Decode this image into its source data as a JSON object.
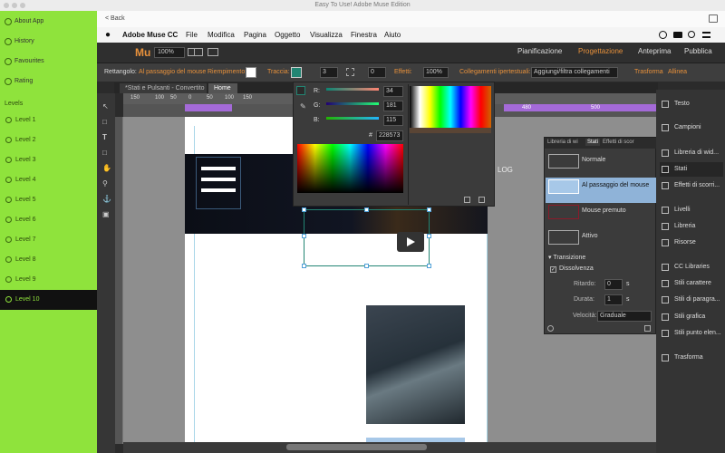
{
  "window": {
    "title": "Easy To Use! Adobe Muse Edition"
  },
  "sidebar": {
    "nav": [
      {
        "label": "About App",
        "icon": "info-icon"
      },
      {
        "label": "History",
        "icon": "clock-icon"
      },
      {
        "label": "Favourites",
        "icon": "heart-icon"
      },
      {
        "label": "Rating",
        "icon": "star-icon"
      }
    ],
    "levels_header": "Levels",
    "levels": [
      "Level 1",
      "Level 2",
      "Level 3",
      "Level 4",
      "Level 5",
      "Level 6",
      "Level 7",
      "Level 8",
      "Level 9",
      "Level 10"
    ],
    "active_level": "Level 10"
  },
  "back": {
    "label": "< Back"
  },
  "menubar": {
    "app": "Adobe Muse CC",
    "items": [
      "File",
      "Modifica",
      "Pagina",
      "Oggetto",
      "Visualizza",
      "Finestra",
      "Aiuto"
    ]
  },
  "appbar": {
    "logo": "Mu",
    "zoom": "100%",
    "modes": [
      "Pianificazione",
      "Progettazione",
      "Anteprima",
      "Pubblica"
    ],
    "active_mode": "Progettazione"
  },
  "propbar": {
    "object_label": "Rettangolo:",
    "state_label": "Al passaggio del mouse",
    "fill_label": "Riempimento:",
    "stroke_label": "Traccia:",
    "stroke_value": "3",
    "corner_value": "0",
    "effects_label": "Effetti:",
    "opacity_value": "100%",
    "links_label": "Collegamenti ipertestuali:",
    "links_value": "Aggiungi/filtra collegamenti",
    "transform_label": "Trasforma",
    "align_label": "Allinea"
  },
  "tabs": [
    "*Stati e Pulsanti - Convertito",
    "Home"
  ],
  "active_tab": "Home",
  "ruler": {
    "top_marks": [
      "150",
      "100",
      "50",
      "0",
      "50",
      "100",
      "150"
    ],
    "right_marks": [
      "480",
      "500"
    ]
  },
  "colorpicker": {
    "r_label": "R:",
    "g_label": "G:",
    "b_label": "B:",
    "r": "34",
    "g": "181",
    "b": "115",
    "hex_label": "#",
    "hex": "228573"
  },
  "stati_panel": {
    "tabs": [
      "Libreria di wi",
      "Stati",
      "Effetti di scor"
    ],
    "active_tab": "Stati",
    "states": [
      {
        "label": "Normale",
        "color": "#3b3b3b",
        "border": "#aaaaaa"
      },
      {
        "label": "Al passaggio del mouse",
        "color": "#a7c8e8",
        "border": "#ffffff"
      },
      {
        "label": "Mouse premuto",
        "color": "#3b3b3b",
        "border": "#8c1a2a"
      },
      {
        "label": "Attivo",
        "color": "#3b3b3b",
        "border": "#aaaaaa"
      }
    ],
    "selected_state": "Al passaggio del mouse",
    "transition_header": "Transizione",
    "fade_label": "Dissolvenza",
    "fade_checked": true,
    "delay_label": "Ritardo:",
    "delay_value": "0",
    "delay_unit": "s",
    "duration_label": "Durata:",
    "duration_value": "1",
    "duration_unit": "s",
    "speed_label": "Velocità:",
    "speed_value": "Graduale"
  },
  "right_panel": {
    "items": [
      {
        "label": "Testo",
        "icon": "text-icon"
      },
      {
        "label": "Campioni",
        "icon": "swatches-icon"
      },
      {
        "label": "Libreria di wid...",
        "icon": "widget-library-icon"
      },
      {
        "label": "Stati",
        "icon": "states-icon"
      },
      {
        "label": "Effetti di scorri...",
        "icon": "scroll-effects-icon"
      },
      {
        "label": "Livelli",
        "icon": "layers-icon"
      },
      {
        "label": "Libreria",
        "icon": "library-icon"
      },
      {
        "label": "Risorse",
        "icon": "assets-icon"
      },
      {
        "label": "CC Libraries",
        "icon": "cc-libraries-icon"
      },
      {
        "label": "Stili carattere",
        "icon": "character-styles-icon"
      },
      {
        "label": "Stili di paragra...",
        "icon": "paragraph-styles-icon"
      },
      {
        "label": "Stili grafica",
        "icon": "graphic-styles-icon"
      },
      {
        "label": "Stili punto elen...",
        "icon": "bullet-styles-icon"
      },
      {
        "label": "Trasforma",
        "icon": "transform-icon"
      }
    ],
    "selected": "Stati"
  },
  "canvas": {
    "hero_text": "LOG"
  },
  "colors": {
    "accent": "#8fe33c",
    "orange": "#e8913b",
    "selection": "#4fa0d8"
  }
}
